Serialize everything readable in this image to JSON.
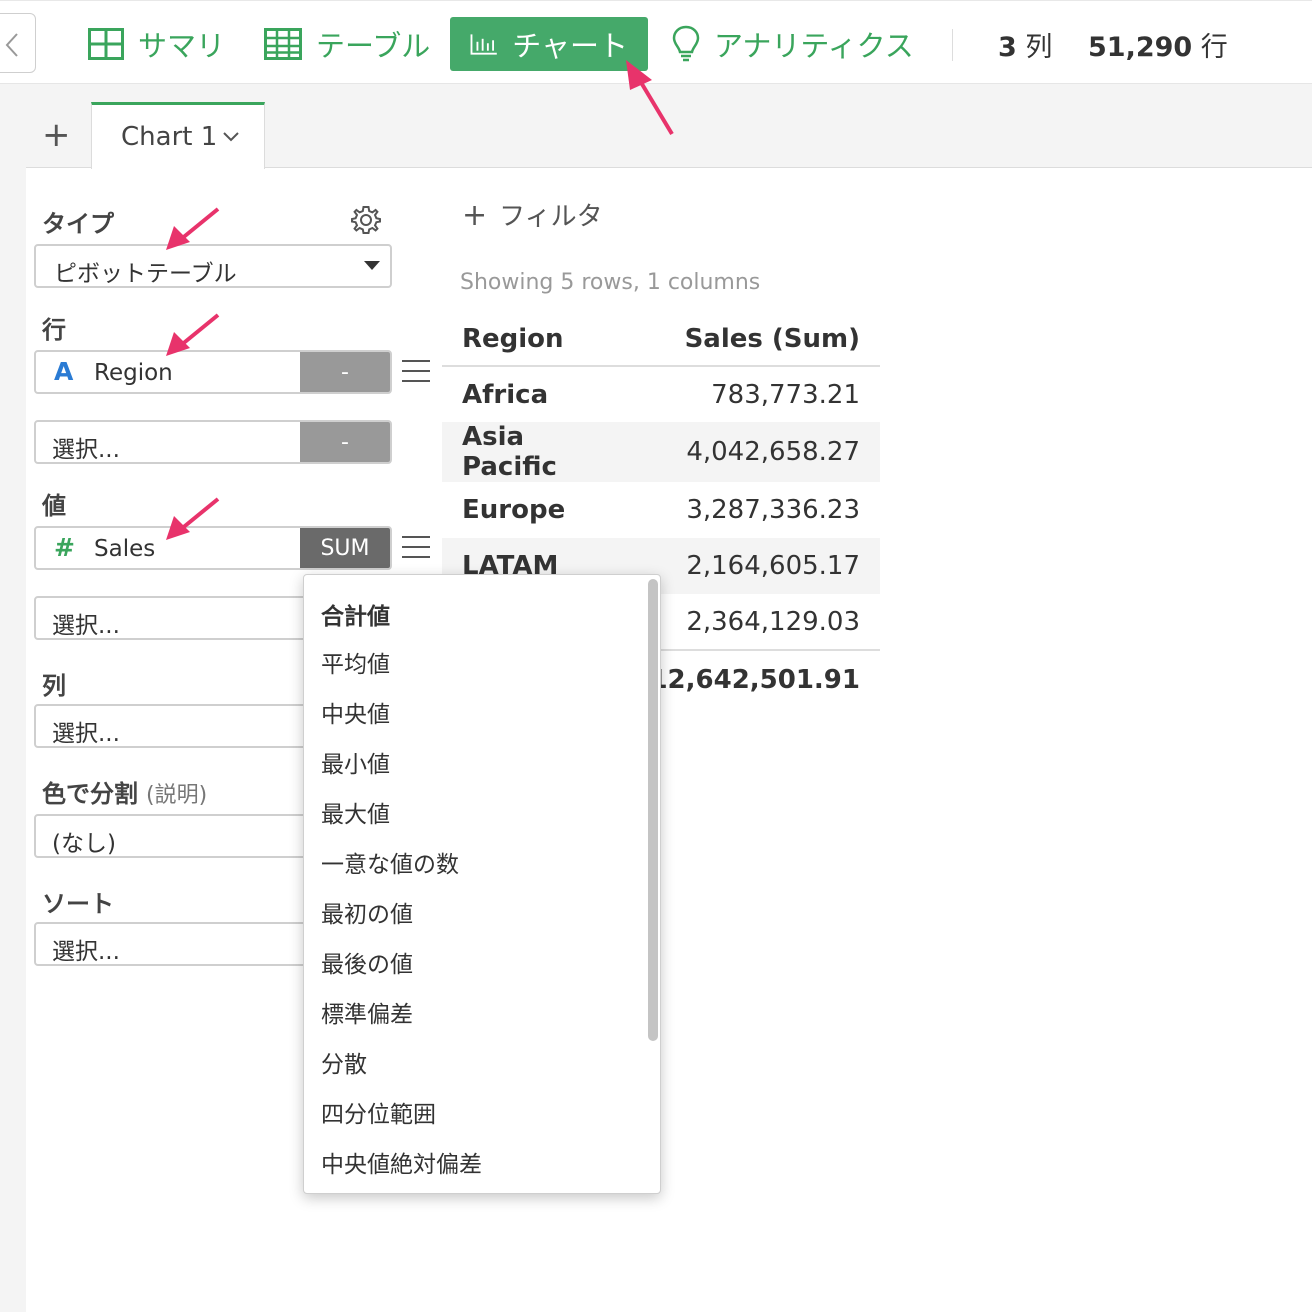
{
  "toolbar": {
    "tabs": [
      {
        "label": "サマリ",
        "icon": "summary-grid-icon"
      },
      {
        "label": "テーブル",
        "icon": "table-icon"
      },
      {
        "label": "チャート",
        "icon": "bar-chart-icon",
        "active": true
      },
      {
        "label": "アナリティクス",
        "icon": "lightbulb-icon"
      }
    ],
    "columns_count": "3",
    "columns_unit": "列",
    "rows_count": "51,290",
    "rows_unit": "行"
  },
  "chart_tab": {
    "label": "Chart 1",
    "add_symbol": "+"
  },
  "settings": {
    "type_label": "タイプ",
    "type_value": "ピボットテーブル",
    "rows_label": "行",
    "row_field": {
      "name": "Region",
      "type_icon": "A",
      "agg": "-"
    },
    "row_empty": {
      "placeholder": "選択...",
      "agg": "-"
    },
    "values_label": "値",
    "value_field": {
      "name": "Sales",
      "type_icon": "#",
      "agg": "SUM"
    },
    "value_empty": {
      "placeholder": "選択..."
    },
    "columns_label": "列",
    "column_empty": {
      "placeholder": "選択..."
    },
    "color_label": "色で分割",
    "color_hint": "(説明)",
    "color_value": "(なし)",
    "sort_label": "ソート",
    "sort_empty": {
      "placeholder": "選択..."
    }
  },
  "result": {
    "filter_label": "フィルタ",
    "showing": "Showing 5 rows, 1 columns",
    "headers": [
      "Region",
      "Sales (Sum)"
    ],
    "rows": [
      {
        "region": "Africa",
        "sales": "783,773.21"
      },
      {
        "region": "Asia Pacific",
        "sales": "4,042,658.27"
      },
      {
        "region": "Europe",
        "sales": "3,287,336.23"
      },
      {
        "region": "LATAM",
        "sales": "2,164,605.17"
      },
      {
        "region": "",
        "sales": "2,364,129.03"
      }
    ],
    "total": "12,642,501.91"
  },
  "agg_menu": {
    "items": [
      "合計値",
      "平均値",
      "中央値",
      "最小値",
      "最大値",
      "一意な値の数",
      "最初の値",
      "最後の値",
      "標準偏差",
      "分散",
      "四分位範囲",
      "中央値絶対偏差"
    ],
    "selected_index": 0
  },
  "colors": {
    "accent_green": "#45a96a",
    "annotation_pink": "#e8336b",
    "text_icon_blue": "#2a7bd4"
  }
}
